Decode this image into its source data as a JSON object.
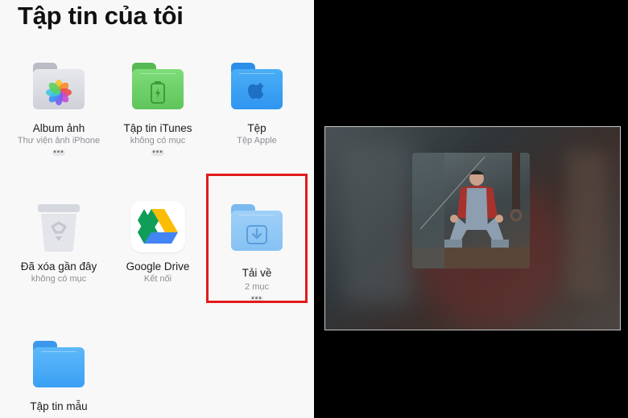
{
  "files": {
    "title": "Tập tin của tôi",
    "items": [
      {
        "name": "Album ảnh",
        "sub": "Thư viện ảnh iPhone",
        "more": "•••"
      },
      {
        "name": "Tập tin iTunes",
        "sub": "không có mục",
        "more": "•••"
      },
      {
        "name": "Tệp",
        "sub": "Tệp Apple",
        "more": ""
      },
      {
        "name": "Đã xóa gần đây",
        "sub": "không có mục",
        "more": ""
      },
      {
        "name": "Google Drive",
        "sub": "Kết nối",
        "more": ""
      },
      {
        "name": "Tải về",
        "sub": "2 mục",
        "more": "•••"
      },
      {
        "name": "Tập tin mẫu",
        "sub": "",
        "more": ""
      }
    ]
  },
  "colors": {
    "highlight": "#e21b1b",
    "folder_blue": "#3aa0f5",
    "folder_green": "#6fd26a",
    "folder_gray": "#c9ccd3"
  },
  "icons": [
    "photos-icon",
    "itunes-icon",
    "apple-icon",
    "trash-icon",
    "google-drive-icon",
    "download-icon",
    "folder-icon"
  ]
}
